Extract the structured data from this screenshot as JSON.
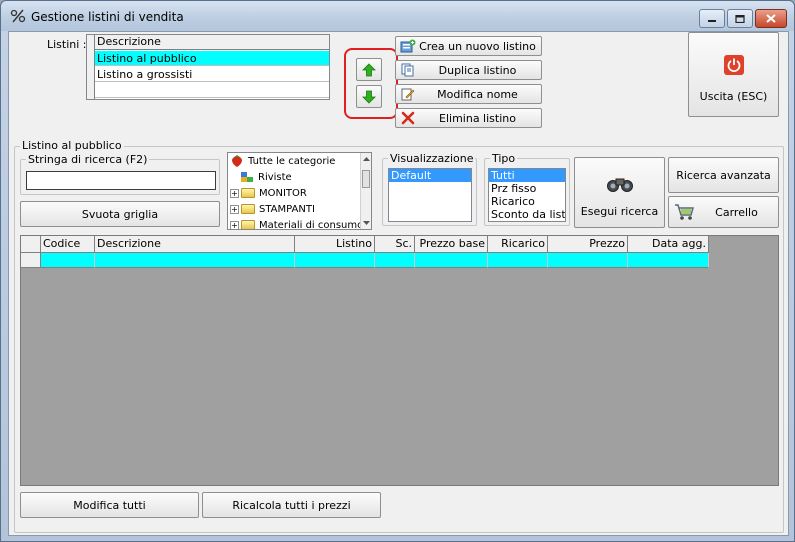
{
  "window": {
    "title": "Gestione listini di vendita"
  },
  "listini": {
    "label": "Listini :",
    "header": "Descrizione",
    "items": [
      "Listino al pubblico",
      "Listino a grossisti"
    ],
    "selected_index": 0
  },
  "buttons": {
    "create": "Crea un nuovo listino",
    "duplicate": "Duplica listino",
    "rename": "Modifica nome",
    "delete": "Elimina listino",
    "exit": "Uscita (ESC)",
    "clear_grid": "Svuota griglia",
    "run_search": "Esegui ricerca",
    "advanced_search": "Ricerca avanzata",
    "cart": "Carrello",
    "edit_all": "Modifica tutti",
    "recalc": "Ricalcola tutti i prezzi"
  },
  "section": {
    "title": "Listino al pubblico"
  },
  "search": {
    "legend": "Stringa di ricerca (F2)",
    "value": ""
  },
  "categories": {
    "items": [
      {
        "label": "Tutte le categorie",
        "kind": "root"
      },
      {
        "label": "Riviste",
        "kind": "leaf"
      },
      {
        "label": "MONITOR",
        "kind": "folder"
      },
      {
        "label": "STAMPANTI",
        "kind": "folder"
      },
      {
        "label": "Materiali di consumo",
        "kind": "folder"
      }
    ]
  },
  "view": {
    "legend": "Visualizzazione",
    "options": [
      "Default"
    ],
    "selected": "Default"
  },
  "type": {
    "legend": "Tipo",
    "options": [
      "Tutti",
      "Prz fisso",
      "Ricarico",
      "Sconto da listin"
    ],
    "selected": "Tutti"
  },
  "grid": {
    "columns": [
      "Codice",
      "Descrizione",
      "Listino",
      "Sc.",
      "Prezzo base",
      "Ricarico",
      "Prezzo",
      "Data agg."
    ]
  },
  "colors": {
    "selection": "#00ffff",
    "list_highlight": "#3399ff",
    "arrow_green": "#2fae1f",
    "highlight_box": "#e02020",
    "exit_icon": "#e0412a"
  }
}
